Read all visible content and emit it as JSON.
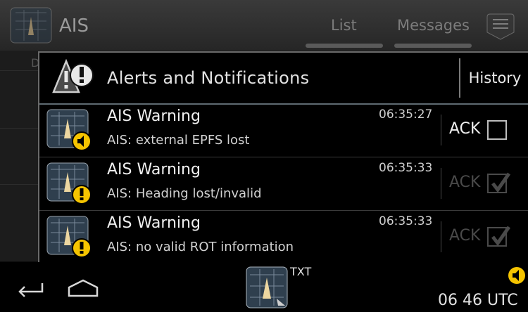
{
  "app_bar": {
    "title": "AIS",
    "tabs": [
      {
        "label": "List"
      },
      {
        "label": "Messages"
      }
    ]
  },
  "background": {
    "letter": "D"
  },
  "dialog": {
    "title": "Alerts and Notifications",
    "history_label": "History",
    "alerts": [
      {
        "title": "AIS Warning",
        "message": "AIS: external EPFS lost",
        "time": "06:35:27",
        "ack_label": "ACK",
        "acknowledged": false,
        "badge_icon": "speaker-icon"
      },
      {
        "title": "AIS Warning",
        "message": "AIS: Heading lost/invalid",
        "time": "06:35:33",
        "ack_label": "ACK",
        "acknowledged": true,
        "badge_icon": "exclamation-icon"
      },
      {
        "title": "AIS Warning",
        "message": "AIS: no valid ROT information",
        "time": "06:35:33",
        "ack_label": "ACK",
        "acknowledged": true,
        "badge_icon": "exclamation-icon"
      }
    ]
  },
  "navbar": {
    "txt_label": "TXT",
    "time": "06 46 UTC"
  },
  "colors": {
    "badge": "#f5c400",
    "background": "#000000"
  }
}
